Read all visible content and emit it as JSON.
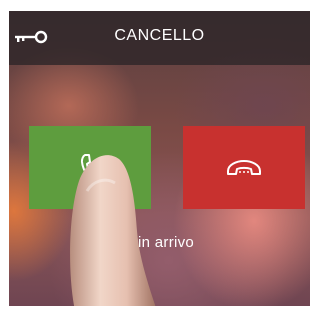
{
  "header": {
    "title": "CANCELLO",
    "key_icon": "key-icon"
  },
  "call": {
    "answer_icon": "phone-icon",
    "hangup_icon": "phone-hangup-icon",
    "status_text": "a in arrivo"
  },
  "colors": {
    "answer": "#5e9d3e",
    "hangup": "#c8312f",
    "topbar": "#2d2628"
  }
}
